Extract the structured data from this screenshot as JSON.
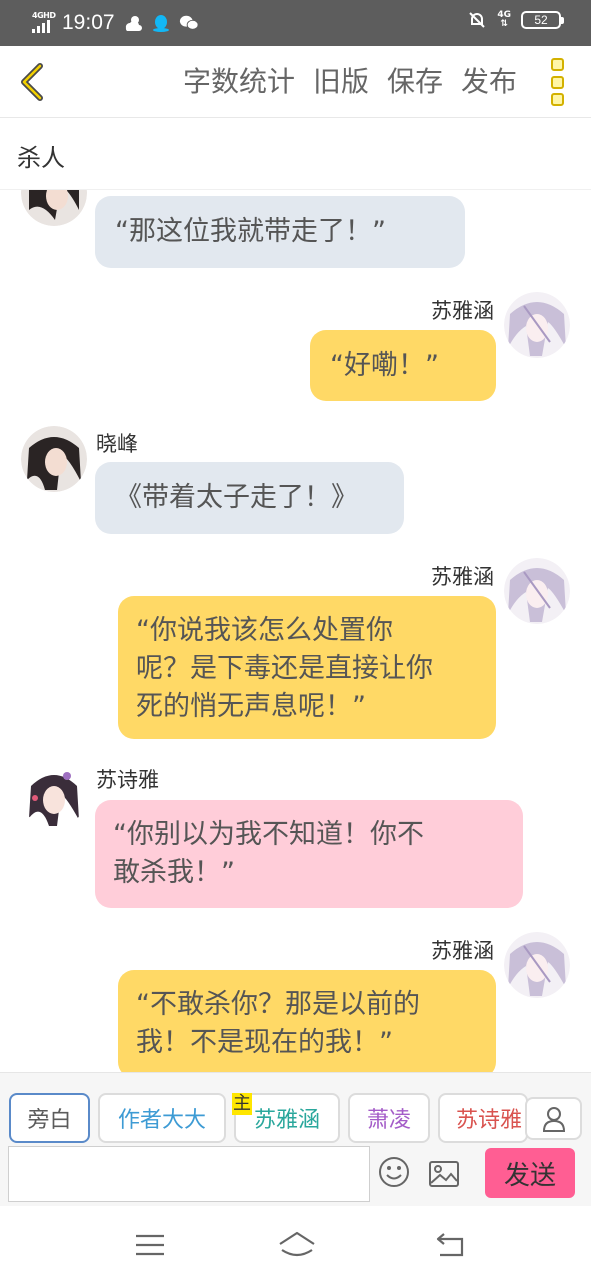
{
  "status": {
    "network": "4GHD",
    "time": "19:07",
    "network_right": "4G",
    "battery": "52"
  },
  "header": {
    "actions": [
      "字数统计",
      "旧版",
      "保存",
      "发布"
    ]
  },
  "title": "杀人",
  "messages": [
    {
      "side": "left",
      "name": "",
      "text": "“那这位我就带走了！”",
      "color": "grey"
    },
    {
      "side": "right",
      "name": "苏雅涵",
      "text": "“好嘞！”",
      "color": "yellow"
    },
    {
      "side": "left",
      "name": "晓峰",
      "text": "《带着太子走了！》",
      "color": "grey"
    },
    {
      "side": "right",
      "name": "苏雅涵",
      "lines": [
        "“你说我该怎么处置你",
        "呢？是下毒还是直接让你",
        "死的悄无声息呢！”"
      ],
      "color": "yellow"
    },
    {
      "side": "left",
      "name": "苏诗雅",
      "lines": [
        "“你别以为我不知道！你不",
        "敢杀我！”"
      ],
      "color": "pink"
    },
    {
      "side": "right",
      "name": "苏雅涵",
      "lines": [
        "“不敢杀你？那是以前的",
        "我！不是现在的我！”"
      ],
      "color": "yellow"
    }
  ],
  "characters": {
    "main_mark": "主",
    "chips": [
      {
        "label": "旁白",
        "color": "#5b5b5b"
      },
      {
        "label": "作者大大",
        "color": "#3d9bd4"
      },
      {
        "label": "苏雅涵",
        "color": "#2aa79c"
      },
      {
        "label": "萧凌",
        "color": "#a45cc8"
      },
      {
        "label": "苏诗雅",
        "color": "#d9534f"
      }
    ]
  },
  "composer": {
    "input_value": "",
    "send_label": "发送"
  },
  "colors": {
    "accent_yellow": "#ffd966",
    "bubble_grey": "#e2e8ef",
    "bubble_pink": "#ffcdd9",
    "send_pink": "#ff5e93"
  }
}
